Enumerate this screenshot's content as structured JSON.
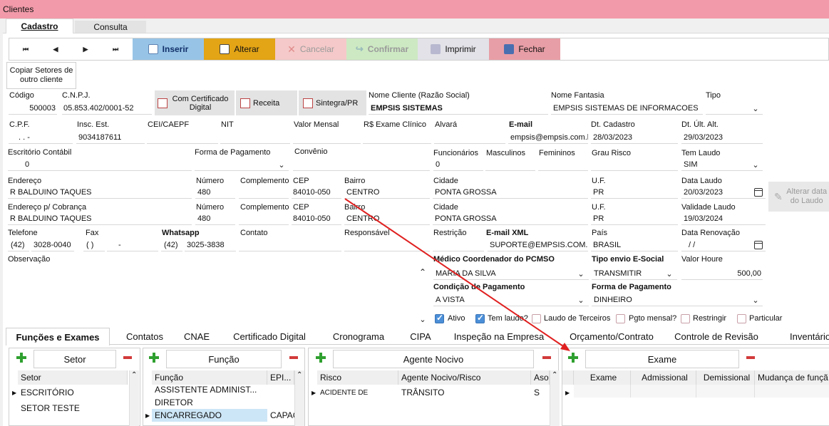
{
  "window": {
    "title": "Clientes"
  },
  "main_tabs": [
    {
      "label": "Cadastro"
    },
    {
      "label": "Consulta"
    }
  ],
  "nav": {
    "first": "⏮",
    "prev": "◀",
    "next": "▶",
    "last": "⏭"
  },
  "toolbar": {
    "inserir": "Inserir",
    "alterar": "Alterar",
    "cancelar": "Cancelar",
    "confirmar": "Confirmar",
    "imprimir": "Imprimir",
    "fechar": "Fechar"
  },
  "copy_button": "Copiar Setores de outro cliente",
  "fields": {
    "codigo": {
      "label": "Código",
      "value": "500003"
    },
    "cnpj": {
      "label": "C.N.P.J.",
      "value": "05.853.402/0001-52"
    },
    "cert_btn": "Com Certificado Digital",
    "receita_btn": "Receita",
    "sintegra_btn": "Sintegra/PR",
    "nome_cliente": {
      "label": "Nome Cliente (Razão Social)",
      "value": "EMPSIS SISTEMAS"
    },
    "nome_fantasia": {
      "label": "Nome Fantasia",
      "value": "EMPSIS SISTEMAS DE INFORMACOES"
    },
    "tipo": {
      "label": "Tipo",
      "value": ""
    },
    "cpf": {
      "label": "C.P.F.",
      "value": ".   .   -"
    },
    "insc_est": {
      "label": "Insc. Est.",
      "value": "9034187611"
    },
    "cei": {
      "label": "CEI/CAEPF",
      "value": ""
    },
    "nit": {
      "label": "NIT",
      "value": ""
    },
    "valor_mensal": {
      "label": "Valor Mensal",
      "value": ""
    },
    "exame_clinico": {
      "label": "R$ Exame Clínico",
      "value": ""
    },
    "alvara": {
      "label": "Alvará",
      "value": ""
    },
    "email": {
      "label": "E-mail",
      "value": "empsis@empsis.com.b"
    },
    "dt_cadastro": {
      "label": "Dt. Cadastro",
      "value": "28/03/2023"
    },
    "dt_ult_alt": {
      "label": "Dt. Últ. Alt.",
      "value": "29/03/2023"
    },
    "escritorio": {
      "label": "Escritório Contábil",
      "value": "0"
    },
    "forma_pgto": {
      "label": "Forma de Pagamento",
      "value": ""
    },
    "convenio": {
      "label": "Convênio",
      "value": ""
    },
    "funcionarios": {
      "label": "Funcionários",
      "value": "0"
    },
    "masculinos": {
      "label": "Masculinos",
      "value": ""
    },
    "femininos": {
      "label": "Femininos",
      "value": ""
    },
    "grau_risco": {
      "label": "Grau Risco",
      "value": ""
    },
    "tem_laudo": {
      "label": "Tem Laudo",
      "value": "SIM"
    },
    "endereco": {
      "label": "Endereço",
      "value": "R BALDUINO TAQUES"
    },
    "numero": {
      "label": "Número",
      "value": "480"
    },
    "complemento": {
      "label": "Complemento",
      "value": ""
    },
    "cep": {
      "label": "CEP",
      "value": "84010-050"
    },
    "bairro": {
      "label": "Bairro",
      "value": "CENTRO"
    },
    "cidade": {
      "label": "Cidade",
      "value": "PONTA GROSSA"
    },
    "uf": {
      "label": "U.F.",
      "value": "PR"
    },
    "data_laudo": {
      "label": "Data Laudo",
      "value": "20/03/2023"
    },
    "endereco_cob": {
      "label": "Endereço p/ Cobrança",
      "value": "R BALDUINO TAQUES"
    },
    "numero2": {
      "label": "Número",
      "value": "480"
    },
    "complemento2": {
      "label": "Complemento",
      "value": ""
    },
    "cep2": {
      "label": "CEP",
      "value": "84010-050"
    },
    "bairro2": {
      "label": "Bairro",
      "value": "CENTRO"
    },
    "cidade2": {
      "label": "Cidade",
      "value": "PONTA GROSSA"
    },
    "uf2": {
      "label": "U.F.",
      "value": "PR"
    },
    "validade_laudo": {
      "label": "Validade Laudo",
      "value": "19/03/2024"
    },
    "telefone": {
      "label": "Telefone",
      "ddd": "(42)",
      "value": "3028-0040"
    },
    "fax": {
      "label": "Fax",
      "ddd": "(  )",
      "value": "-"
    },
    "whatsapp": {
      "label": "Whatsapp",
      "ddd": "(42)",
      "value": "3025-3838"
    },
    "contato": {
      "label": "Contato",
      "value": ""
    },
    "responsavel": {
      "label": "Responsável",
      "value": ""
    },
    "restricao": {
      "label": "Restrição",
      "value": ""
    },
    "email_xml": {
      "label": "E-mail XML",
      "value": "SUPORTE@EMPSIS.COM.B"
    },
    "pais": {
      "label": "País",
      "value": "BRASIL"
    },
    "data_renovacao": {
      "label": "Data Renovação",
      "value": "/  /"
    },
    "observacao": {
      "label": "Observação"
    },
    "medico": {
      "label": "Médico Coordenador do PCMSO",
      "value": "MARIA DA SILVA"
    },
    "tipo_envio": {
      "label": "Tipo envio E-Social",
      "value": "TRANSMITIR"
    },
    "valor_houre": {
      "label": "Valor Houre",
      "value": "500,00"
    },
    "cond_pgto": {
      "label": "Condição de Pagamento",
      "value": "A VISTA"
    },
    "forma_pgto2": {
      "label": "Forma de Pagamento",
      "value": "DINHEIRO"
    }
  },
  "alt_laudo_btn": "Alterar data do Laudo",
  "checkboxes": [
    {
      "label": "Ativo",
      "checked": true
    },
    {
      "label": "Tem laudo?",
      "checked": true
    },
    {
      "label": "Laudo de Terceiros",
      "checked": false
    },
    {
      "label": "Pgto mensal?",
      "checked": false
    },
    {
      "label": "Restringir",
      "checked": false
    },
    {
      "label": "Particular",
      "checked": false
    }
  ],
  "bottom_tabs": [
    "Funções e Exames",
    "Contatos",
    "CNAE",
    "Certificado Digital",
    "Cronograma",
    "CIPA",
    "Inspeção na Empresa",
    "Orçamento/Contrato",
    "Controle de Revisão",
    "Inventário"
  ],
  "panels": {
    "setor": {
      "title": "Setor",
      "header": "Setor",
      "rows": [
        "ESCRITÓRIO",
        "SETOR TESTE"
      ]
    },
    "funcao": {
      "title": "Função",
      "headers": [
        "Função",
        "EPI..."
      ],
      "rows": [
        [
          "ASSISTENTE  ADMINIST...",
          ""
        ],
        [
          "DIRETOR",
          ""
        ],
        [
          "ENCARREGADO",
          "CAPAC"
        ]
      ]
    },
    "agente": {
      "title": "Agente Nocivo",
      "headers": [
        "Risco",
        "Agente Nocivo/Risco",
        "Aso"
      ],
      "rows": [
        [
          "ACIDENTE DE",
          "TRÂNSITO",
          "S"
        ]
      ]
    },
    "exame": {
      "title": "Exame",
      "headers": [
        "Exame",
        "Admissional",
        "Demissional",
        "Mudança de funçã"
      ]
    }
  },
  "colors": {
    "titlebar": "#f29aa9",
    "inserir": "#97c4e6",
    "alterar": "#e3a415",
    "cancelar": "#f5c9c9",
    "confirmar": "#cde9c3",
    "imprimir": "#e2e2e8",
    "fechar": "#e89ea6",
    "arrow": "#e02020"
  }
}
